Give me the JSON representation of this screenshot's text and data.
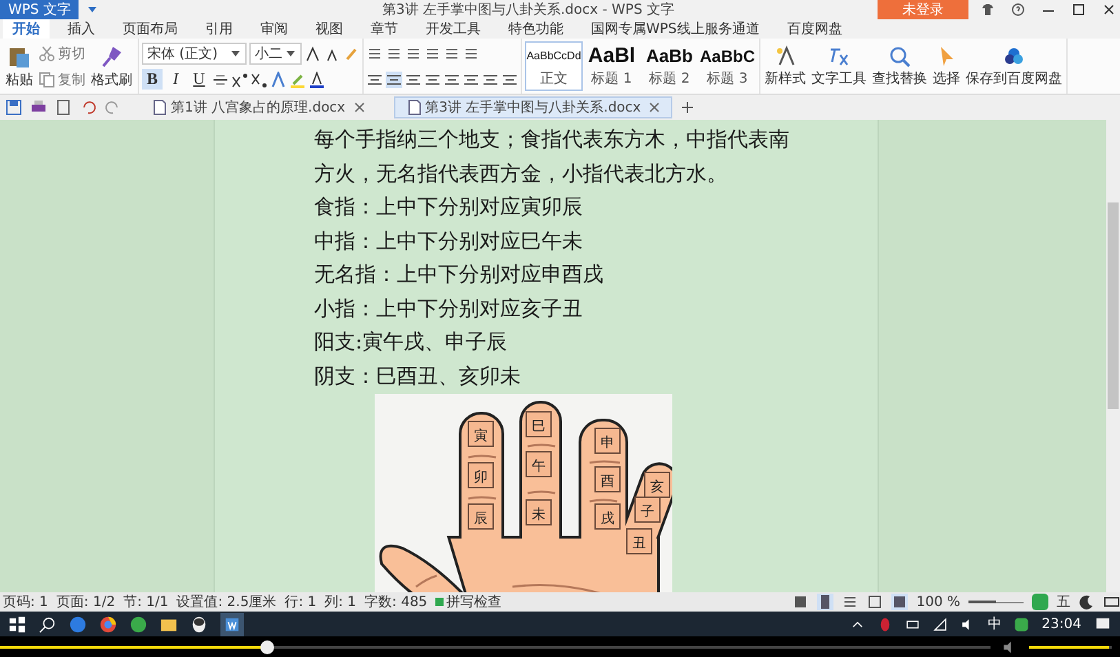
{
  "title_bar": {
    "app_button": "WPS 文字",
    "title": "第3讲 左手掌中图与八卦关系.docx - WPS 文字",
    "login_button": "未登录"
  },
  "menu_tabs": [
    {
      "label": "开始",
      "selected": true
    },
    {
      "label": "插入",
      "selected": false
    },
    {
      "label": "页面布局",
      "selected": false
    },
    {
      "label": "引用",
      "selected": false
    },
    {
      "label": "审阅",
      "selected": false
    },
    {
      "label": "视图",
      "selected": false
    },
    {
      "label": "章节",
      "selected": false
    },
    {
      "label": "开发工具",
      "selected": false
    },
    {
      "label": "特色功能",
      "selected": false
    },
    {
      "label": "国网专属WPS线上服务通道",
      "selected": false
    },
    {
      "label": "百度网盘",
      "selected": false
    }
  ],
  "ribbon": {
    "paste": "粘贴",
    "cut": "剪切",
    "copy": "复制",
    "format_painter": "格式刷",
    "font_name": "宋体 (正文)",
    "font_size": "小二",
    "format_buttons": [
      "B",
      "I",
      "U"
    ],
    "styles": [
      {
        "preview": "AaBbCcDd",
        "name": "正文",
        "selected": true
      },
      {
        "preview": "AaBl",
        "name": "标题 1",
        "selected": false
      },
      {
        "preview": "AaBb",
        "name": "标题 2",
        "selected": false
      },
      {
        "preview": "AaBbC",
        "name": "标题 3",
        "selected": false
      }
    ],
    "tools": [
      {
        "kind": "new-style",
        "label": "新样式"
      },
      {
        "kind": "text-tools",
        "label": "文字工具"
      },
      {
        "kind": "find",
        "label": "查找替换"
      },
      {
        "kind": "select",
        "label": "选择"
      },
      {
        "kind": "cloud",
        "label": "保存到百度网盘"
      }
    ]
  },
  "doc_tabs": [
    {
      "label": "第1讲 八宫象占的原理.docx",
      "selected": false
    },
    {
      "label": "第3讲 左手掌中图与八卦关系.docx",
      "selected": true
    }
  ],
  "document": {
    "lines": [
      "每个手指纳三个地支；食指代表东方木，中指代表南",
      "方火，无名指代表西方金，小指代表北方水。",
      "食指：上中下分别对应寅卯辰",
      "中指：上中下分别对应巳午未",
      "无名指：上中下分别对应申酉戌",
      "小指：上中下分别对应亥子丑",
      "阳支:寅午戌、申子辰",
      "阴支：巳酉丑、亥卯未"
    ],
    "hand": {
      "fingers": [
        [
          "寅",
          "卯",
          "辰"
        ],
        [
          "巳",
          "午",
          "未"
        ],
        [
          "申",
          "酉",
          "戌"
        ],
        [
          "亥",
          "子",
          "丑"
        ]
      ]
    }
  },
  "status_bar": {
    "items": [
      "页码: 1",
      "页面: 1/2",
      "节: 1/1",
      "设置值: 2.5厘米",
      "行: 1",
      "列: 1",
      "字数: 485"
    ],
    "spell_check": "拼写检查",
    "zoom": "100 %",
    "zoom_slider": {
      "level": 0.5
    },
    "ime": "五"
  },
  "taskbar": {
    "ime": "中",
    "time": "23:04"
  },
  "player": {
    "level": 0.27,
    "volume": {
      "level": 0.97
    }
  }
}
